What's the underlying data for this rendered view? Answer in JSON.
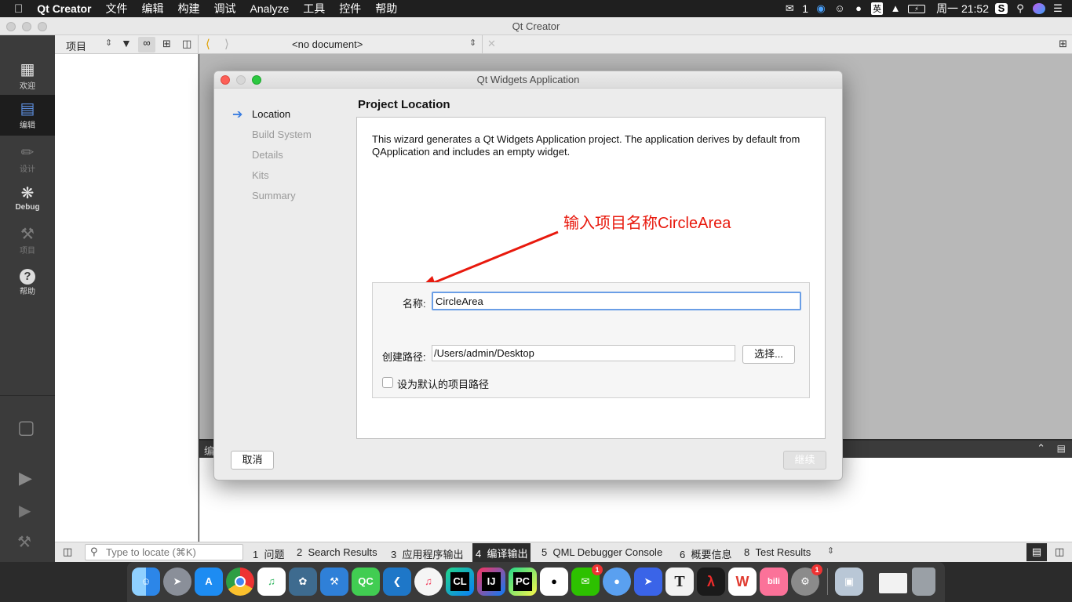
{
  "menubar": {
    "apple": "",
    "items": [
      "Qt Creator",
      "文件",
      "编辑",
      "构建",
      "调试",
      "Analyze",
      "工具",
      "控件",
      "帮助"
    ],
    "wechat_count": "1",
    "input_method": "英",
    "clock": "周一 21:52"
  },
  "window": {
    "title": "Qt Creator"
  },
  "toolbar": {
    "projects_label": "项目",
    "document_selector": "<no document>"
  },
  "modes": [
    {
      "label": "欢迎",
      "icon": "grid-icon"
    },
    {
      "label": "编辑",
      "icon": "edit-icon"
    },
    {
      "label": "设计",
      "icon": "pencil-icon"
    },
    {
      "label": "Debug",
      "icon": "bug-icon"
    },
    {
      "label": "项目",
      "icon": "wrench-icon"
    },
    {
      "label": "帮助",
      "icon": "help-icon"
    }
  ],
  "output_panel_title": "编",
  "dialog": {
    "title": "Qt Widgets Application",
    "steps": [
      "Location",
      "Build System",
      "Details",
      "Kits",
      "Summary"
    ],
    "heading": "Project Location",
    "description": "This wizard generates a Qt Widgets Application project. The application derives by default from QApplication and includes an empty widget.",
    "annotation": "输入项目名称CircleArea",
    "name_label": "名称:",
    "name_value": "CircleArea",
    "path_label": "创建路径:",
    "path_value": "/Users/admin/Desktop",
    "browse_button": "选择...",
    "default_path_checkbox": "设为默认的项目路径",
    "default_path_checked": false,
    "cancel_button": "取消",
    "next_button": "继续"
  },
  "statusbar": {
    "locator_placeholder": "Type to locate (⌘K)",
    "tabs": [
      {
        "num": "1",
        "label": "问题"
      },
      {
        "num": "2",
        "label": "Search Results"
      },
      {
        "num": "3",
        "label": "应用程序输出"
      },
      {
        "num": "4",
        "label": "编译输出"
      },
      {
        "num": "5",
        "label": "QML Debugger Console"
      },
      {
        "num": "6",
        "label": "概要信息"
      },
      {
        "num": "8",
        "label": "Test Results"
      }
    ]
  },
  "dock": {
    "apps": [
      "Finder",
      "Launchpad",
      "App Store",
      "Chrome",
      "Music Player",
      "MySQL Workbench",
      "Xcode",
      "Qt Creator",
      "VS Code",
      "iTunes",
      "CLion",
      "IntelliJ IDEA",
      "PyCharm",
      "QQ",
      "WeChat",
      "Maps",
      "Mail",
      "Typora",
      "Acrobat",
      "WPS",
      "bilibili",
      "System Preferences",
      "Preview",
      "Chrome Window",
      "Trash"
    ],
    "badges": {
      "WeChat": "1",
      "System Preferences": "1"
    },
    "labels": {
      "Qt Creator": "QC",
      "CLion": "CL",
      "IntelliJ IDEA": "IJ",
      "PyCharm": "PC",
      "Typora": "T",
      "WPS": "W",
      "bilibili": "bili"
    }
  },
  "colors": {
    "annotation": "#e8190d",
    "focus": "#6a9ee6",
    "dark_bar": "#3b3b3b"
  }
}
